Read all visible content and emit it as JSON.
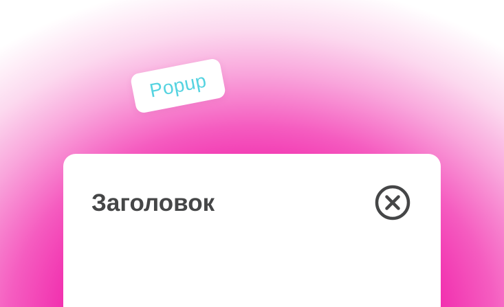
{
  "tag": {
    "label": "Popup"
  },
  "popup": {
    "title": "Заголовок",
    "close_icon": "close-circle-x-icon"
  },
  "colors": {
    "accent_pink": "#ef0aa0",
    "tag_text": "#55d3e0",
    "title_text": "#454647",
    "popup_bg": "#ffffff"
  }
}
